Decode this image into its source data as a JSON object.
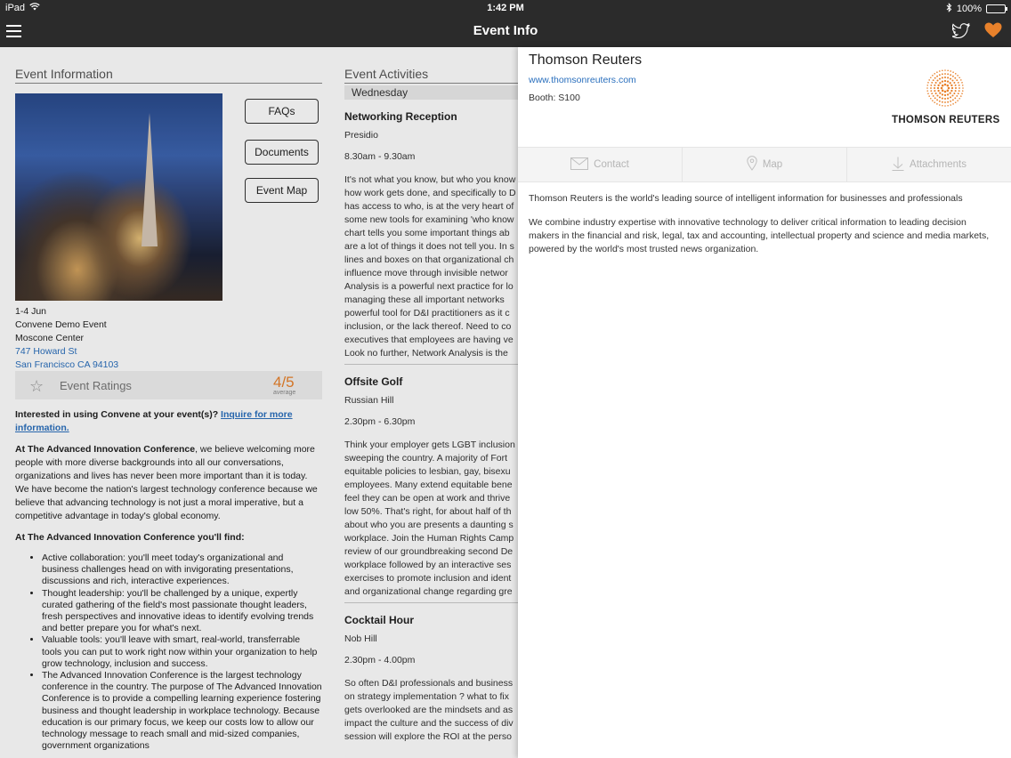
{
  "status_bar": {
    "device": "iPad",
    "time": "1:42 PM",
    "battery": "100%"
  },
  "nav": {
    "title": "Event Info"
  },
  "left": {
    "section_title": "Event Information",
    "buttons": {
      "faqs": "FAQs",
      "documents": "Documents",
      "event_map": "Event Map"
    },
    "date": "1-4 Jun",
    "event_name": "Convene Demo Event",
    "venue": "Moscone Center",
    "address_line1": "747 Howard St",
    "address_line2": "San Francisco CA 94103",
    "ratings": {
      "label": "Event Ratings",
      "score": "4/5",
      "avg_label": "average"
    },
    "inquire_prefix": "Interested in using Convene at your event(s)? ",
    "inquire_link": "Inquire for more information.",
    "intro_bold": "At The Advanced Innovation Conference",
    "intro_rest": ", we believe welcoming more people with more diverse backgrounds into all our conversations, organizations and lives has never been more important than it is today. We have become the nation's largest technology conference because we believe that advancing technology is not just a moral imperative, but a competitive advantage in today's global economy.",
    "find_heading": "At The Advanced Innovation Conference you'll find:",
    "bullets": [
      "Active collaboration: you'll meet today's organizational and business challenges head on with invigorating presentations, discussions and rich, interactive experiences.",
      "Thought leadership: you'll be challenged by a unique, expertly curated gathering of the field's most passionate thought leaders, fresh perspectives and innovative ideas to identify evolving trends and better prepare you for what's next.",
      "Valuable tools: you'll leave with smart, real-world, transferrable tools you can put to work right now within your organization to help grow technology, inclusion and success.",
      "The Advanced Innovation Conference is the largest technology conference in the country. The purpose of The Advanced Innovation Conference is to provide a compelling learning experience fostering business and thought leadership in workplace technology. Because education is our primary focus, we keep our costs low to allow our technology message to reach small and mid-sized companies, government organizations"
    ]
  },
  "middle": {
    "section_title": "Event Activities",
    "day": "Wednesday",
    "activities": [
      {
        "title": "Networking Reception",
        "location": "Presidio",
        "time": "8.30am - 9.30am",
        "desc_lines": [
          "It's not what you know, but who you know",
          "how work gets done, and specifically to D",
          "has access to who, is at the very heart of",
          "some new tools for examining 'who know",
          "chart tells you some important things ab",
          "are a lot of things it does not tell you. In s",
          "lines and boxes on that organizational ch",
          "influence move through invisible networ",
          "Analysis is a powerful next practice for lo",
          "managing these all important networks",
          "powerful tool for D&I practitioners as it c",
          "inclusion, or the lack thereof. Need to co",
          "executives that employees are having ve",
          "Look no further, Network Analysis is the"
        ]
      },
      {
        "title": "Offsite Golf",
        "location": "Russian Hill",
        "time": "2.30pm - 6.30pm",
        "desc_lines": [
          "Think your employer gets LGBT inclusion",
          "sweeping the country. A majority of Fort",
          "equitable policies to lesbian, gay, bisexu",
          "employees. Many extend equitable bene",
          "feel they can be open at work and thrive",
          "low 50%. That's right, for about half of th",
          "about who you are presents a daunting s",
          "workplace. Join the Human Rights Camp",
          "review of our groundbreaking second De",
          "workplace followed by an interactive ses",
          "exercises to promote inclusion and ident",
          "and organizational change regarding gre"
        ]
      },
      {
        "title": "Cocktail Hour",
        "location": "Nob Hill",
        "time": "2.30pm - 4.00pm",
        "desc_lines": [
          "So often D&I professionals and business",
          "on strategy implementation ? what to fix",
          "gets overlooked are the mindsets and as",
          "impact the culture and the success of div",
          "session will explore the ROI at the perso"
        ]
      }
    ]
  },
  "panel": {
    "company": "Thomson Reuters",
    "website": "www.thomsonreuters.com",
    "booth": "Booth: S100",
    "logo_text": "THOMSON REUTERS",
    "tabs": {
      "contact": "Contact",
      "map": "Map",
      "attachments": "Attachments"
    },
    "description": [
      "Thomson Reuters is the world's leading source of intelligent information for businesses and professionals",
      "We combine industry expertise with innovative technology to deliver critical information to leading decision makers in the financial and risk, legal, tax and accounting, intellectual property and science and media markets, powered by the world's most trusted news organization."
    ]
  },
  "colors": {
    "accent_orange": "#e8812b",
    "link_blue": "#2a6fbd",
    "bar_dark": "#2b2b2b"
  }
}
